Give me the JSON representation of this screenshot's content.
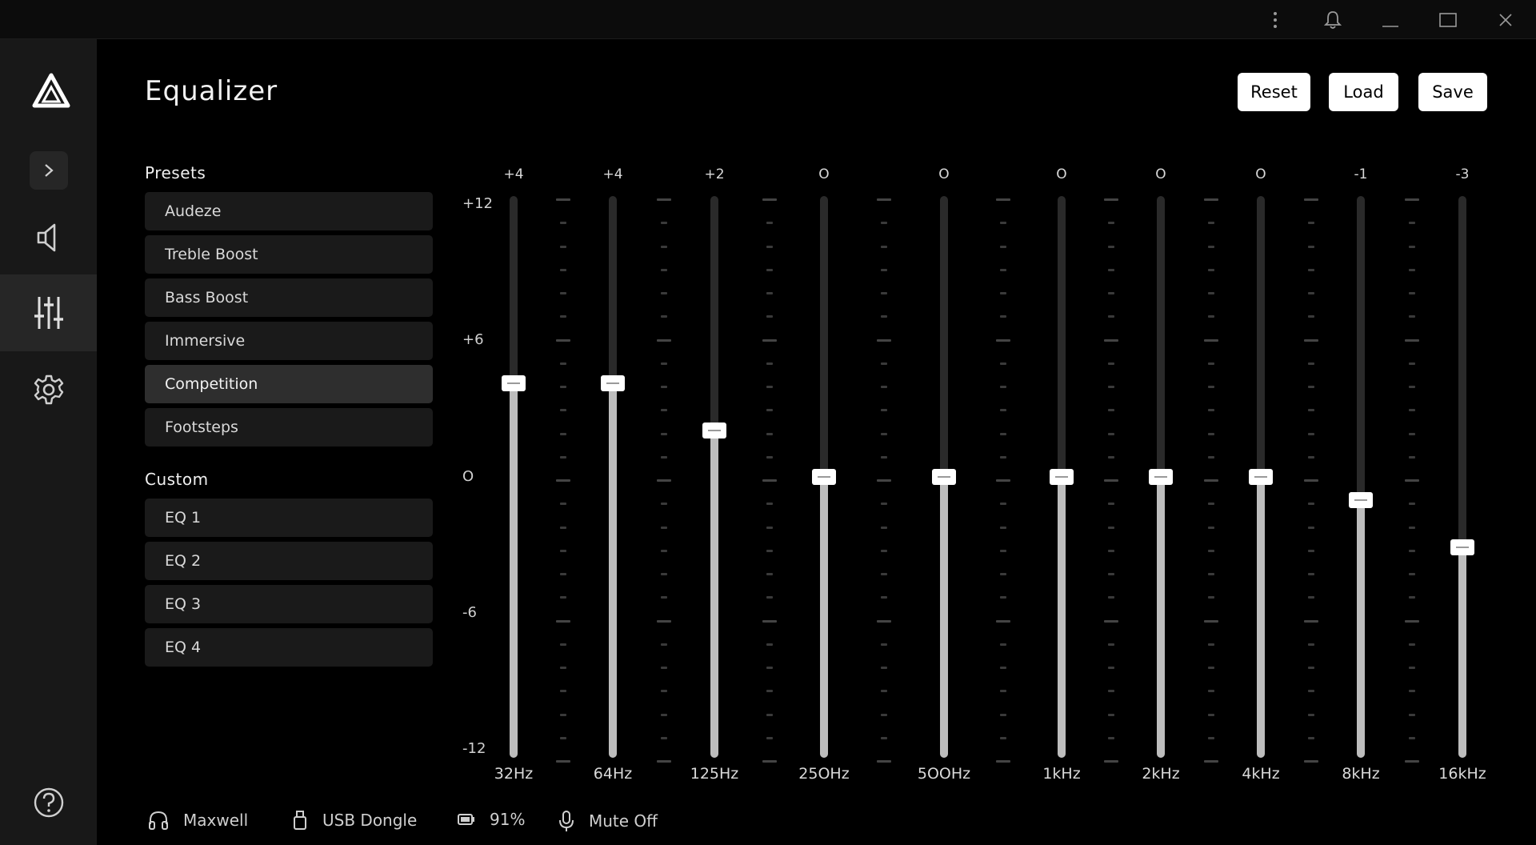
{
  "window": {
    "controls": [
      "more-icon",
      "bell-icon",
      "minimize-icon",
      "maximize-icon",
      "close-icon"
    ]
  },
  "nav": {
    "items": [
      {
        "name": "speaker-icon",
        "active": false
      },
      {
        "name": "equalizer-icon",
        "active": true
      },
      {
        "name": "gear-icon",
        "active": false
      }
    ]
  },
  "header": {
    "title": "Equalizer",
    "reset_label": "Reset",
    "load_label": "Load",
    "save_label": "Save"
  },
  "presets": {
    "label": "Presets",
    "items": [
      "Audeze",
      "Treble Boost",
      "Bass Boost",
      "Immersive",
      "Competition",
      "Footsteps"
    ],
    "selected": "Competition"
  },
  "custom": {
    "label": "Custom",
    "items": [
      "EQ 1",
      "EQ 2",
      "EQ 3",
      "EQ 4"
    ]
  },
  "eq": {
    "scale": [
      "+12",
      "+6",
      "O",
      "-6",
      "-12"
    ],
    "range": [
      -12,
      12
    ],
    "bands": [
      {
        "freq": "32Hz",
        "label": "+4",
        "value": 4
      },
      {
        "freq": "64Hz",
        "label": "+4",
        "value": 4
      },
      {
        "freq": "125Hz",
        "label": "+2",
        "value": 2
      },
      {
        "freq": "25OHz",
        "label": "O",
        "value": 0
      },
      {
        "freq": "5OOHz",
        "label": "O",
        "value": 0
      },
      {
        "freq": "1kHz",
        "label": "O",
        "value": 0
      },
      {
        "freq": "2kHz",
        "label": "O",
        "value": 0
      },
      {
        "freq": "4kHz",
        "label": "O",
        "value": 0
      },
      {
        "freq": "8kHz",
        "label": "-1",
        "value": -1
      },
      {
        "freq": "16kHz",
        "label": "-3",
        "value": -3
      }
    ]
  },
  "status": {
    "device": "Maxwell",
    "connection": "USB Dongle",
    "battery": "91%",
    "mic": "Mute Off"
  }
}
